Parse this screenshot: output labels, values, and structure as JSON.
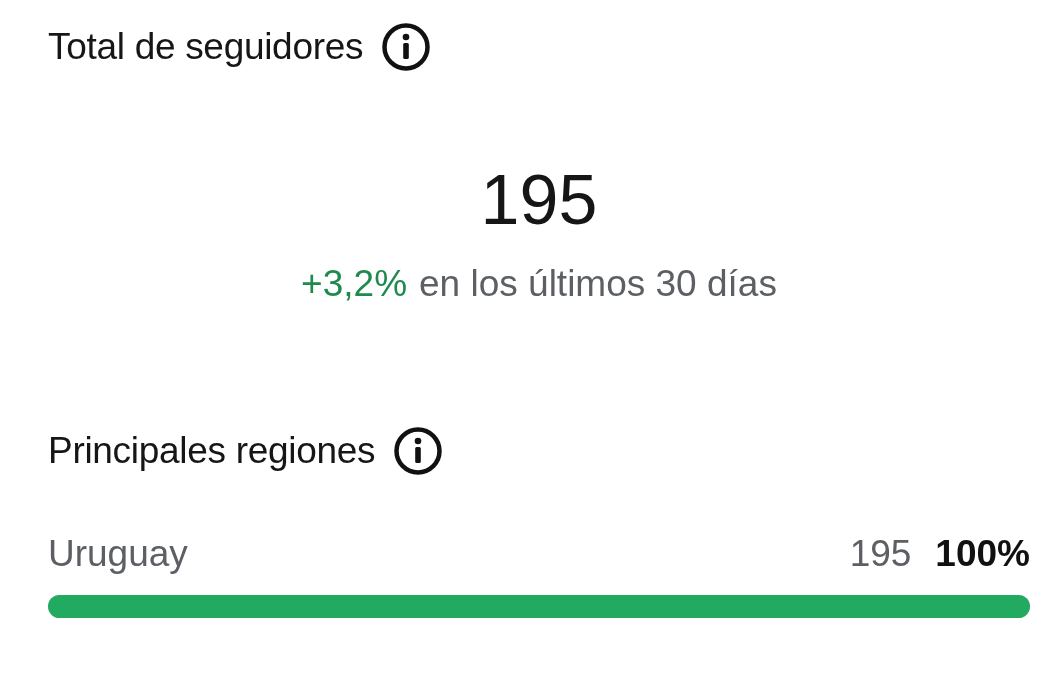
{
  "followers": {
    "title": "Total de seguidores",
    "value": "195",
    "change": "+3,2%",
    "period": "en los últimos 30 días"
  },
  "regions": {
    "title": "Principales regiones",
    "items": [
      {
        "name": "Uruguay",
        "count": "195",
        "percent": "100%",
        "level": 1
      }
    ]
  }
}
